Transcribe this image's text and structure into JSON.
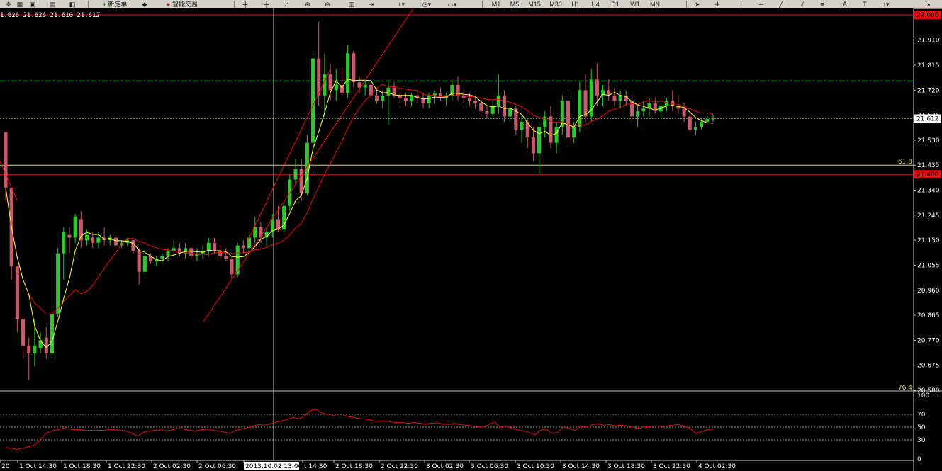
{
  "toolbar": {
    "buttons": [
      {
        "name": "new-order-button",
        "label": "新定单",
        "icon": "plus-icon"
      },
      {
        "name": "expert-advisors-button",
        "label": "智能交易",
        "icon": "robot-icon"
      }
    ],
    "periods": [
      "M1",
      "M5",
      "M15",
      "M30",
      "H1",
      "H4",
      "D1",
      "W1",
      "MN"
    ]
  },
  "colors": {
    "background": "#000000",
    "bull_candle": "#2ec82e",
    "bear_candle": "#c85a6e",
    "fast_ma": "#ffff40",
    "slow_ma": "#e01010",
    "level_line": "#e01010",
    "fib_line": "#d8d860",
    "dashdot_line": "#2ec82e",
    "bid_line": "#3cb43c",
    "rsi_line": "#e01010",
    "axis_text": "#ffffff",
    "crosshair": "#c8c8c8"
  },
  "ohlc_readout": "1.626 21.626 21.610 21.612",
  "price_axis": {
    "ticks": [
      "21.910",
      "21.815",
      "21.720",
      "21.625",
      "21.530",
      "21.435",
      "21.340",
      "21.245",
      "21.150",
      "21.055",
      "20.960",
      "20.865",
      "20.770",
      "20.675",
      "20.580"
    ],
    "top_level_label": "22.006",
    "current_price_label": "21.612",
    "support_level_label": "21.400",
    "fib_label": "61.8",
    "fib_bottom_label": "76.4"
  },
  "rsi_axis": {
    "ticks": [
      "100",
      "70",
      "50",
      "30",
      "0"
    ]
  },
  "time_axis": {
    "labels": [
      "20",
      "1 Oct 14:30",
      "1 Oct 18:30",
      "1 Oct 22:30",
      "2 Oct 02:30",
      "2 Oct 06:30",
      "2013.10.02 13:00",
      "t 14:30",
      "2 Oct 18:30",
      "2 Oct 22:30",
      "3 Oct 02:30",
      "3 Oct 06:30",
      "3 Oct 10:30",
      "3 Oct 14:30",
      "3 Oct 18:30",
      "3 Oct 22:30",
      "4 Oct 02:30"
    ],
    "highlight_label": "2013.10.02 13:00"
  },
  "chart_data": {
    "type": "candlestick",
    "ylim": [
      20.58,
      22.006
    ],
    "levels": {
      "resistance": 22.006,
      "support": 21.4,
      "dash_dot": 21.755,
      "bid": 21.612,
      "fib_61_8": 21.435
    },
    "candles": [
      [
        21.56,
        21.56,
        21.3,
        21.35
      ],
      [
        21.35,
        21.35,
        21.0,
        21.05
      ],
      [
        21.05,
        21.05,
        20.8,
        20.85
      ],
      [
        20.85,
        20.86,
        20.7,
        20.75
      ],
      [
        20.75,
        20.78,
        20.62,
        20.72
      ],
      [
        20.72,
        20.85,
        20.67,
        20.75
      ],
      [
        20.74,
        20.8,
        20.72,
        20.77
      ],
      [
        20.78,
        20.82,
        20.7,
        20.72
      ],
      [
        20.72,
        20.9,
        20.7,
        20.87
      ],
      [
        20.87,
        21.12,
        20.86,
        21.1
      ],
      [
        21.1,
        21.2,
        21.0,
        21.18
      ],
      [
        21.17,
        21.2,
        21.1,
        21.16
      ],
      [
        21.16,
        21.25,
        21.14,
        21.24
      ],
      [
        21.23,
        21.26,
        21.12,
        21.15
      ],
      [
        21.15,
        21.19,
        21.13,
        21.17
      ],
      [
        21.16,
        21.18,
        21.12,
        21.14
      ],
      [
        21.14,
        21.18,
        21.12,
        21.16
      ],
      [
        21.16,
        21.2,
        21.13,
        21.15
      ],
      [
        21.15,
        21.17,
        21.13,
        21.16
      ],
      [
        21.16,
        21.17,
        21.12,
        21.13
      ],
      [
        21.13,
        21.15,
        21.12,
        21.14
      ],
      [
        21.14,
        21.16,
        21.13,
        21.15
      ],
      [
        21.15,
        21.16,
        21.1,
        21.11
      ],
      [
        21.11,
        21.12,
        20.98,
        21.03
      ],
      [
        21.03,
        21.1,
        21.02,
        21.09
      ],
      [
        21.09,
        21.1,
        21.06,
        21.07
      ],
      [
        21.07,
        21.09,
        21.05,
        21.08
      ],
      [
        21.08,
        21.1,
        21.06,
        21.09
      ],
      [
        21.09,
        21.12,
        21.07,
        21.11
      ],
      [
        21.11,
        21.15,
        21.09,
        21.12
      ],
      [
        21.12,
        21.14,
        21.09,
        21.1
      ],
      [
        21.1,
        21.14,
        21.08,
        21.12
      ],
      [
        21.12,
        21.13,
        21.08,
        21.09
      ],
      [
        21.09,
        21.12,
        21.07,
        21.1
      ],
      [
        21.1,
        21.13,
        21.08,
        21.11
      ],
      [
        21.11,
        21.16,
        21.09,
        21.14
      ],
      [
        21.14,
        21.16,
        21.1,
        21.11
      ],
      [
        21.11,
        21.13,
        21.08,
        21.09
      ],
      [
        21.09,
        21.12,
        21.07,
        21.08
      ],
      [
        21.08,
        21.09,
        21.0,
        21.02
      ],
      [
        21.02,
        21.14,
        21.01,
        21.13
      ],
      [
        21.13,
        21.15,
        21.1,
        21.12
      ],
      [
        21.12,
        21.18,
        21.1,
        21.16
      ],
      [
        21.16,
        21.24,
        21.14,
        21.2
      ],
      [
        21.2,
        21.22,
        21.14,
        21.16
      ],
      [
        21.16,
        21.2,
        21.13,
        21.18
      ],
      [
        21.18,
        21.25,
        21.16,
        21.23
      ],
      [
        21.23,
        21.28,
        21.18,
        21.19
      ],
      [
        21.19,
        21.3,
        21.18,
        21.28
      ],
      [
        21.28,
        21.4,
        21.26,
        21.38
      ],
      [
        21.38,
        21.46,
        21.36,
        21.42
      ],
      [
        21.42,
        21.46,
        21.3,
        21.33
      ],
      [
        21.33,
        21.55,
        21.32,
        21.52
      ],
      [
        21.52,
        21.86,
        21.4,
        21.84
      ],
      [
        21.84,
        21.98,
        21.66,
        21.7
      ],
      [
        21.7,
        21.86,
        21.62,
        21.78
      ],
      [
        21.78,
        21.82,
        21.68,
        21.72
      ],
      [
        21.72,
        21.8,
        21.68,
        21.74
      ],
      [
        21.74,
        21.8,
        21.7,
        21.71
      ],
      [
        21.71,
        21.89,
        21.69,
        21.86
      ],
      [
        21.86,
        21.87,
        21.73,
        21.75
      ],
      [
        21.75,
        21.77,
        21.71,
        21.73
      ],
      [
        21.73,
        21.76,
        21.7,
        21.74
      ],
      [
        21.74,
        21.76,
        21.69,
        21.7
      ],
      [
        21.7,
        21.73,
        21.67,
        21.68
      ],
      [
        21.68,
        21.72,
        21.65,
        21.7
      ],
      [
        21.7,
        21.76,
        21.59,
        21.73
      ],
      [
        21.73,
        21.75,
        21.69,
        21.7
      ],
      [
        21.7,
        21.73,
        21.67,
        21.69
      ],
      [
        21.69,
        21.71,
        21.66,
        21.68
      ],
      [
        21.68,
        21.71,
        21.66,
        21.7
      ],
      [
        21.7,
        21.72,
        21.67,
        21.69
      ],
      [
        21.69,
        21.71,
        21.65,
        21.67
      ],
      [
        21.67,
        21.71,
        21.65,
        21.7
      ],
      [
        21.7,
        21.72,
        21.67,
        21.71
      ],
      [
        21.71,
        21.73,
        21.68,
        21.69
      ],
      [
        21.69,
        21.71,
        21.66,
        21.7
      ],
      [
        21.7,
        21.76,
        21.68,
        21.74
      ],
      [
        21.74,
        21.77,
        21.68,
        21.7
      ],
      [
        21.7,
        21.72,
        21.67,
        21.69
      ],
      [
        21.69,
        21.71,
        21.66,
        21.68
      ],
      [
        21.68,
        21.7,
        21.65,
        21.67
      ],
      [
        21.67,
        21.68,
        21.62,
        21.64
      ],
      [
        21.64,
        21.66,
        21.61,
        21.63
      ],
      [
        21.63,
        21.68,
        21.62,
        21.66
      ],
      [
        21.66,
        21.78,
        21.63,
        21.7
      ],
      [
        21.7,
        21.72,
        21.6,
        21.62
      ],
      [
        21.62,
        21.66,
        21.6,
        21.65
      ],
      [
        21.65,
        21.66,
        21.55,
        21.57
      ],
      [
        21.57,
        21.62,
        21.52,
        21.6
      ],
      [
        21.6,
        21.61,
        21.5,
        21.54
      ],
      [
        21.54,
        21.58,
        21.45,
        21.48
      ],
      [
        21.48,
        21.6,
        21.4,
        21.58
      ],
      [
        21.58,
        21.64,
        21.54,
        21.62
      ],
      [
        21.62,
        21.66,
        21.5,
        21.52
      ],
      [
        21.52,
        21.6,
        21.48,
        21.58
      ],
      [
        21.58,
        21.7,
        21.55,
        21.68
      ],
      [
        21.68,
        21.72,
        21.52,
        21.54
      ],
      [
        21.54,
        21.6,
        21.52,
        21.58
      ],
      [
        21.58,
        21.75,
        21.56,
        21.72
      ],
      [
        21.72,
        21.78,
        21.6,
        21.62
      ],
      [
        21.62,
        21.8,
        21.6,
        21.76
      ],
      [
        21.76,
        21.82,
        21.66,
        21.7
      ],
      [
        21.7,
        21.74,
        21.66,
        21.72
      ],
      [
        21.72,
        21.76,
        21.68,
        21.7
      ],
      [
        21.7,
        21.73,
        21.66,
        21.68
      ],
      [
        21.68,
        21.72,
        21.65,
        21.7
      ],
      [
        21.7,
        21.72,
        21.66,
        21.68
      ],
      [
        21.68,
        21.7,
        21.6,
        21.62
      ],
      [
        21.62,
        21.66,
        21.58,
        21.64
      ],
      [
        21.64,
        21.68,
        21.62,
        21.65
      ],
      [
        21.65,
        21.69,
        21.62,
        21.67
      ],
      [
        21.67,
        21.69,
        21.63,
        21.64
      ],
      [
        21.64,
        21.67,
        21.62,
        21.66
      ],
      [
        21.66,
        21.69,
        21.64,
        21.68
      ],
      [
        21.68,
        21.72,
        21.64,
        21.66
      ],
      [
        21.66,
        21.7,
        21.63,
        21.65
      ],
      [
        21.65,
        21.67,
        21.6,
        21.62
      ],
      [
        21.62,
        21.64,
        21.56,
        21.57
      ],
      [
        21.57,
        21.6,
        21.55,
        21.58
      ],
      [
        21.58,
        21.61,
        21.57,
        21.6
      ],
      [
        21.6,
        21.62,
        21.59,
        21.61
      ],
      [
        21.61,
        21.63,
        21.6,
        21.612
      ]
    ],
    "rsi": {
      "levels": [
        70,
        50,
        30
      ],
      "values": [
        18,
        17,
        15,
        17,
        19,
        22,
        30,
        40,
        44,
        46,
        48,
        47,
        46,
        46,
        45,
        45,
        45,
        45,
        46,
        46,
        45,
        44,
        40,
        36,
        42,
        44,
        45,
        46,
        44,
        46,
        48,
        47,
        45,
        44,
        46,
        47,
        45,
        44,
        42,
        40,
        45,
        47,
        49,
        52,
        54,
        53,
        55,
        58,
        60,
        62,
        65,
        63,
        68,
        76,
        78,
        72,
        70,
        68,
        67,
        68,
        66,
        64,
        63,
        62,
        60,
        59,
        60,
        58,
        57,
        57,
        56,
        57,
        56,
        55,
        56,
        57,
        55,
        54,
        56,
        54,
        53,
        52,
        51,
        50,
        54,
        58,
        50,
        52,
        48,
        46,
        44,
        42,
        38,
        45,
        47,
        40,
        42,
        50,
        48,
        45,
        52,
        50,
        54,
        55,
        53,
        54,
        52,
        53,
        52,
        50,
        48,
        50,
        51,
        52,
        51,
        52,
        53,
        54,
        52,
        48,
        40,
        43,
        46,
        47
      ]
    },
    "ma_fast_period": 5,
    "ma_slow_period": 13
  }
}
